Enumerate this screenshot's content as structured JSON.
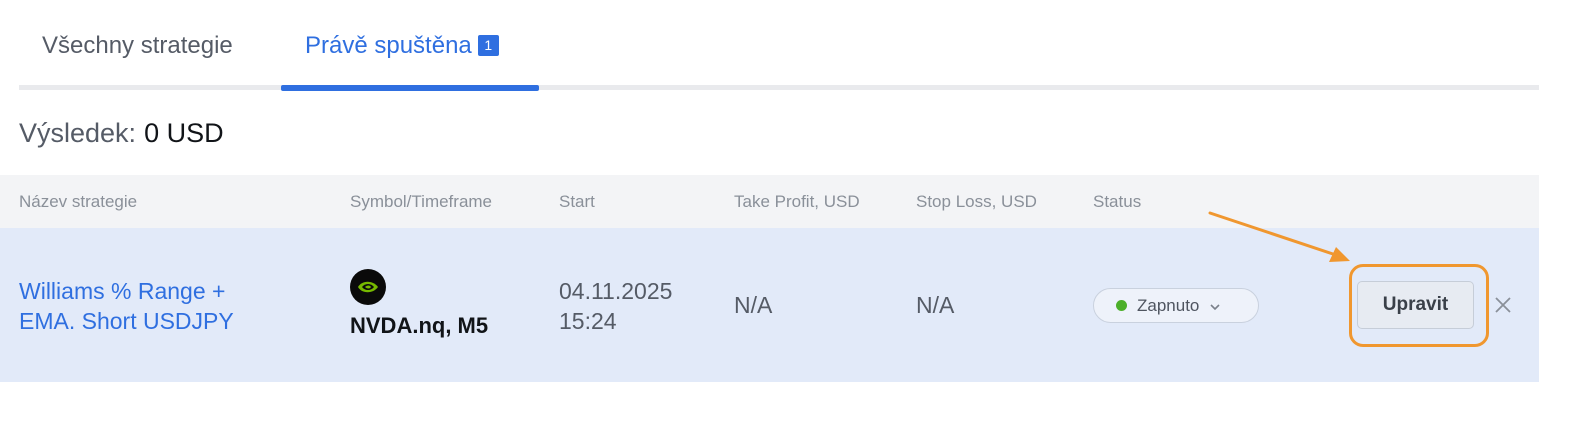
{
  "tabs": [
    {
      "label": "Všechny strategie",
      "active": false
    },
    {
      "label": "Právě spuštěna",
      "active": true,
      "badge": "1"
    }
  ],
  "result": {
    "label": "Výsledek:",
    "value": "0 USD"
  },
  "table": {
    "columns": [
      "Název strategie",
      "Symbol/Timeframe",
      "Start",
      "Take Profit, USD",
      "Stop Loss, USD",
      "Status"
    ],
    "rows": [
      {
        "name_line1": "Williams % Range +",
        "name_line2": "EMA. Short USDJPY",
        "symbol_icon": "nvidia-logo-icon",
        "symbol": "NVDA.nq, M5",
        "start_date": "04.11.2025",
        "start_time": "15:24",
        "take_profit": "N/A",
        "stop_loss": "N/A",
        "status": "Zapnuto",
        "edit_label": "Upravit"
      }
    ]
  },
  "colors": {
    "accent": "#2f6fe0",
    "row_highlight": "#e2eaf9",
    "status_on": "#4caf2a",
    "annotation": "#f0972f"
  }
}
